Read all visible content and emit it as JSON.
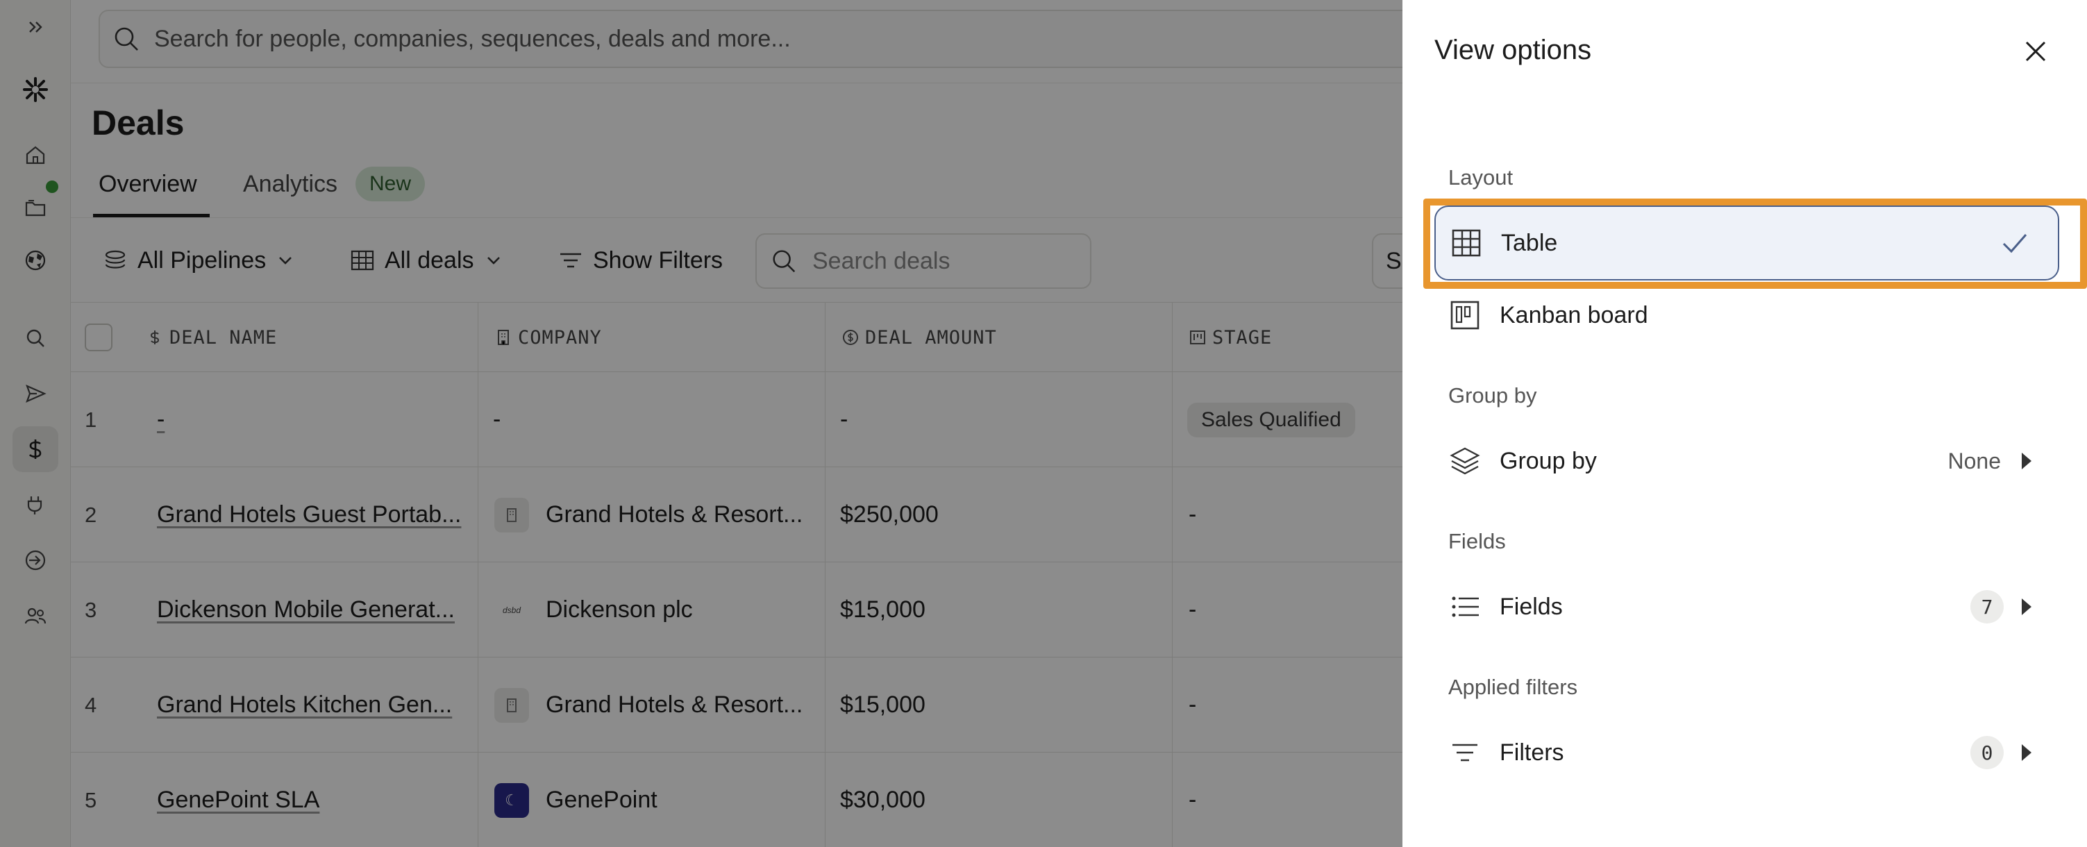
{
  "search": {
    "placeholder": "Search for people, companies, sequences, deals and more..."
  },
  "page": {
    "title": "Deals"
  },
  "tabs": [
    {
      "label": "Overview"
    },
    {
      "label": "Analytics",
      "badge": "New"
    }
  ],
  "filters": {
    "pipelines": "All Pipelines",
    "deals": "All deals",
    "show_filters": "Show Filters",
    "search_placeholder": "Search deals",
    "sort_partial": "S"
  },
  "table": {
    "headers": [
      "DEAL NAME",
      "COMPANY",
      "DEAL AMOUNT",
      "STAGE"
    ],
    "rows": [
      {
        "num": "1",
        "name": "-",
        "company": "-",
        "amount": "-",
        "stage": "Sales Qualified",
        "logo": ""
      },
      {
        "num": "2",
        "name": "Grand Hotels Guest Portab...",
        "company": "Grand Hotels & Resort...",
        "amount": "$250,000",
        "stage": "-",
        "logo": "building"
      },
      {
        "num": "3",
        "name": "Dickenson Mobile Generat...",
        "company": "Dickenson plc",
        "amount": "$15,000",
        "stage": "-",
        "logo": "dickenson"
      },
      {
        "num": "4",
        "name": "Grand Hotels Kitchen Gen...",
        "company": "Grand Hotels & Resort...",
        "amount": "$15,000",
        "stage": "-",
        "logo": "building"
      },
      {
        "num": "5",
        "name": "GenePoint SLA",
        "company": "GenePoint",
        "amount": "$30,000",
        "stage": "-",
        "logo": "genepoint"
      }
    ]
  },
  "panel": {
    "title": "View options",
    "layout_label": "Layout",
    "layout_options": [
      "Table",
      "Kanban board"
    ],
    "selected_layout": "Table",
    "group_label": "Group by",
    "group_option": "Group by",
    "group_value": "None",
    "fields_label": "Fields",
    "fields_option": "Fields",
    "fields_count": "7",
    "filters_label": "Applied filters",
    "filters_option": "Filters",
    "filters_count": "0"
  },
  "colors": {
    "highlight": "#e8962e",
    "selected_border": "#4a5f8a",
    "selected_bg": "#eef2f9",
    "status_dot": "#3a9a3a"
  }
}
